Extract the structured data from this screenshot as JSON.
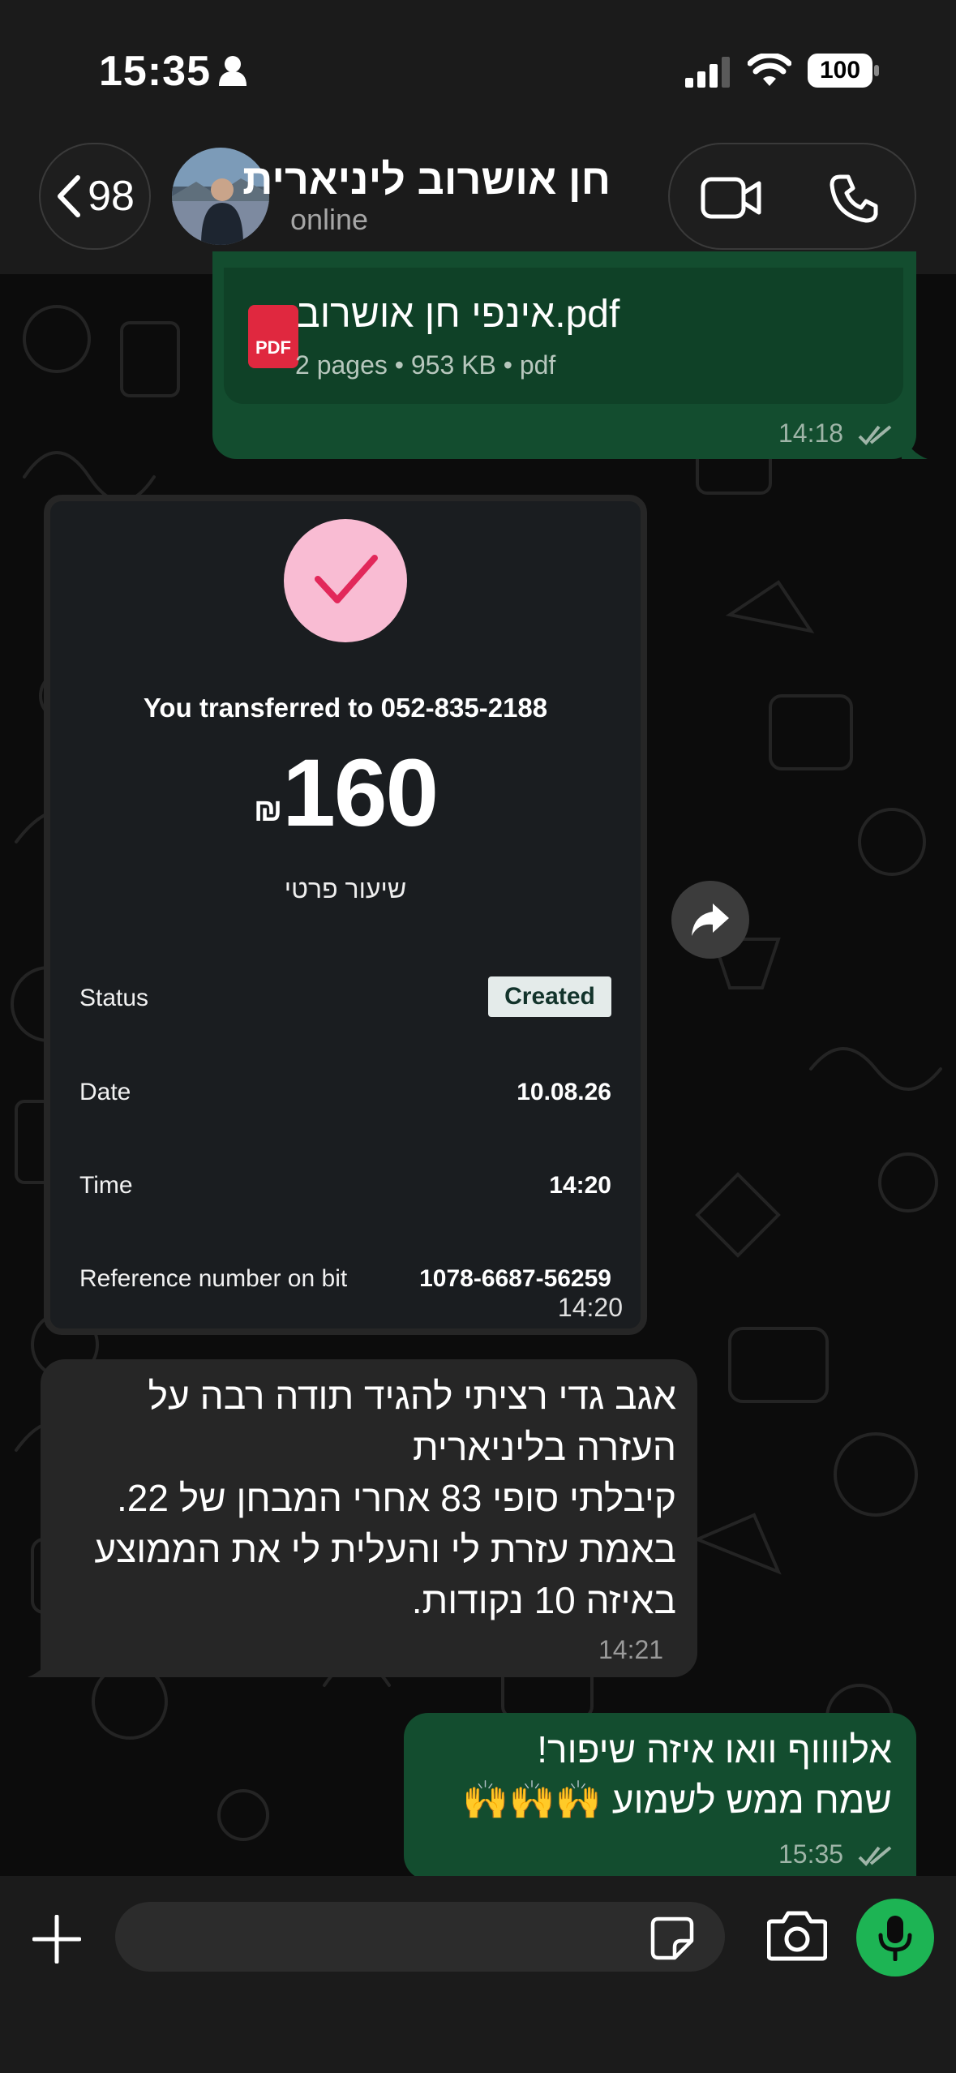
{
  "status_bar": {
    "time": "15:35",
    "battery": "100"
  },
  "header": {
    "back_count": "98",
    "contact_name": "חן אושרוב ליניארית",
    "contact_status": "online"
  },
  "messages": {
    "file": {
      "name": "אינפי חן אושרוב.pdf",
      "badge": "PDF",
      "details": "2 pages • 953 KB • pdf",
      "time": "14:18"
    },
    "transfer": {
      "title": "You transferred to 052-835-2188",
      "currency": "₪",
      "amount": "160",
      "note": "שיעור פרטי",
      "rows": [
        {
          "label": "Status",
          "value": "Created"
        },
        {
          "label": "Date",
          "value": "10.08.26"
        },
        {
          "label": "Time",
          "value": "14:20"
        },
        {
          "label": "Reference number on bit",
          "value": "1078-6687-56259"
        }
      ],
      "time": "14:20"
    },
    "incoming": {
      "lines": [
        "אגב גדי רציתי להגיד תודה רבה על",
        "העזרה בליניארית",
        "קיבלתי סופי 83 אחרי המבחן של 22.",
        "באמת עזרת לי והעלית לי את הממוצע",
        "באיזה 10 נקודות."
      ],
      "time": "14:21"
    },
    "reply": {
      "lines": [
        "אלווווף וואו איזה שיפור!",
        "שמח ממש לשמוע 🙌🙌🙌"
      ],
      "time": "15:35"
    }
  },
  "colors": {
    "outgoing_bubble": "#134d2f",
    "incoming_bubble": "#262626",
    "mic_button": "#1db454",
    "pdf_red": "#e0283f"
  }
}
